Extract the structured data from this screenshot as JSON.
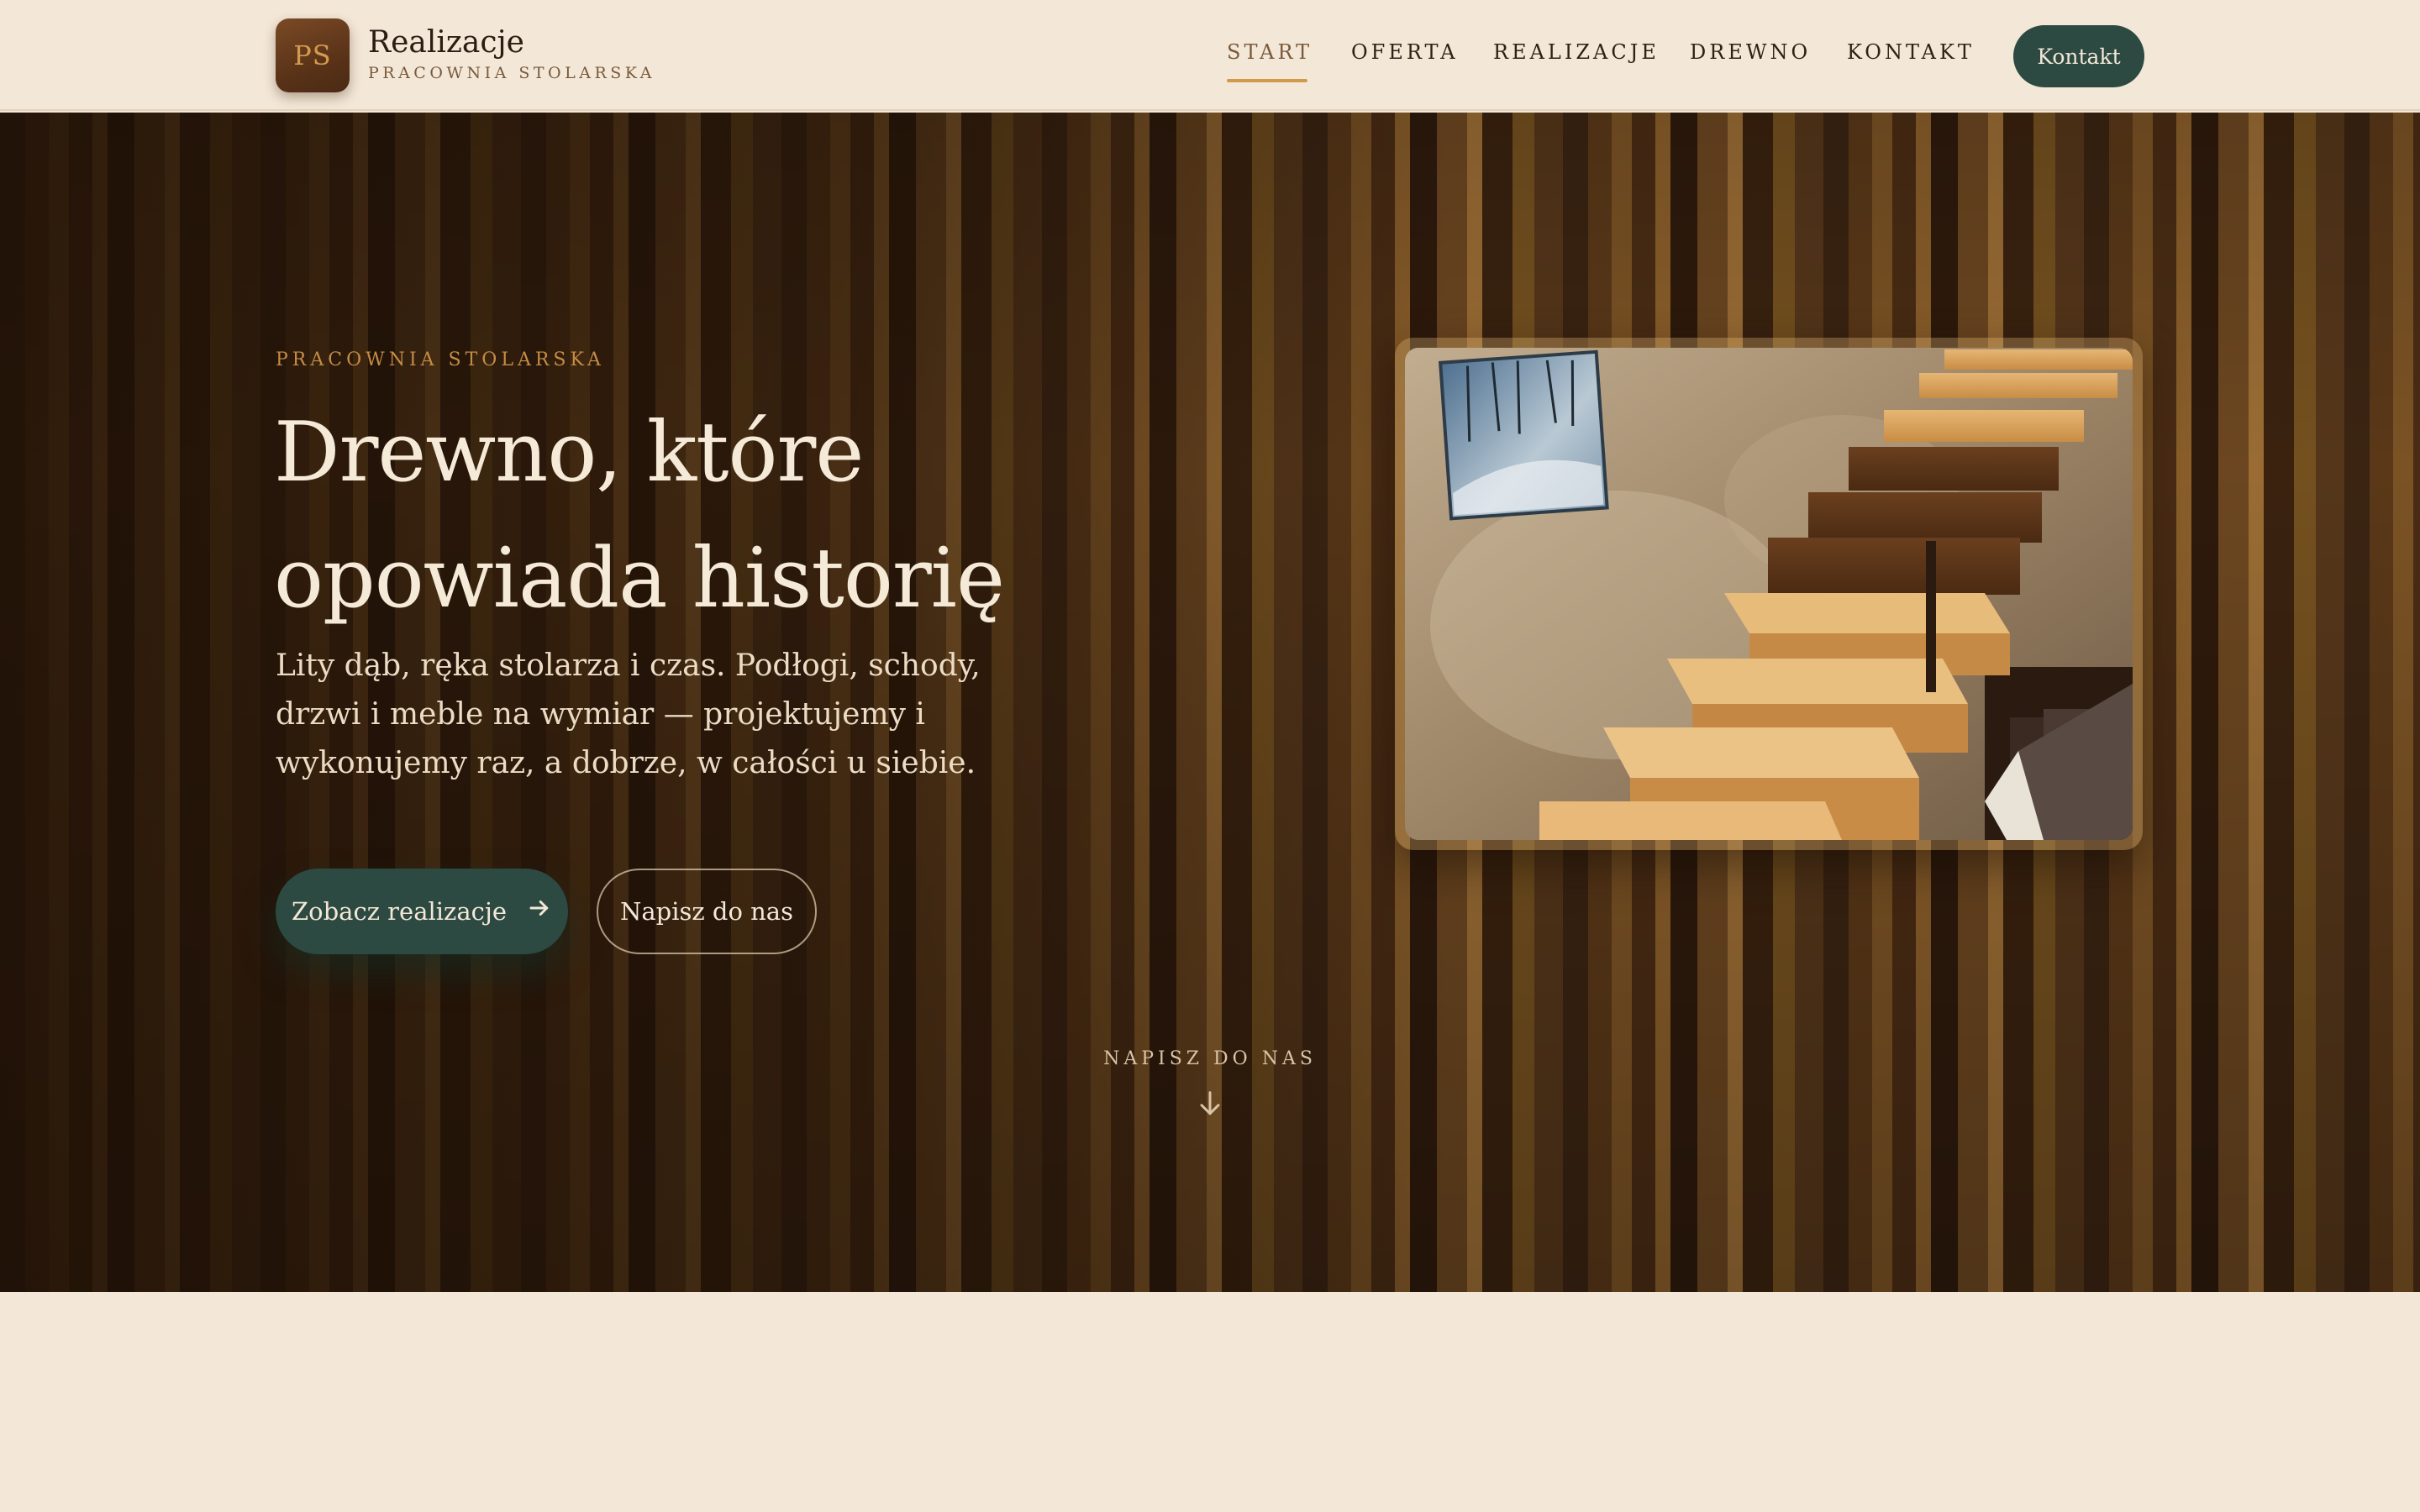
{
  "header": {
    "logo_initials": "PS",
    "brand_title": "Realizacje",
    "brand_subtitle": "PRACOWNIA STOLARSKA",
    "nav": [
      {
        "label": "START",
        "active": true
      },
      {
        "label": "OFERTA",
        "active": false
      },
      {
        "label": "REALIZACJE",
        "active": false
      },
      {
        "label": "DREWNO",
        "active": false
      },
      {
        "label": "KONTAKT",
        "active": false
      }
    ],
    "cta_label": "Kontakt"
  },
  "hero": {
    "eyebrow": "PRACOWNIA STOLARSKA",
    "title": "Drewno, które opowiada historię",
    "lead": "Lity dąb, ręka stolarza i czas. Podłogi, schody, drzwi i meble na wymiar — projektujemy i wykonujemy raz, a dobrze, w całości u siebie.",
    "primary_button": "Zobacz realizacje",
    "secondary_button": "Napisz do nas",
    "scroll_hint": "NAPISZ DO NAS",
    "image_alt": "Schody z litego drewna"
  },
  "colors": {
    "background": "#f3e7d7",
    "accent_green": "#2c4a42",
    "accent_gold": "#d19a4a",
    "text_dark": "#2b1d13"
  },
  "icons": {
    "primary_button_icon": "arrow-right-icon",
    "scroll_icon": "arrow-down-icon"
  }
}
